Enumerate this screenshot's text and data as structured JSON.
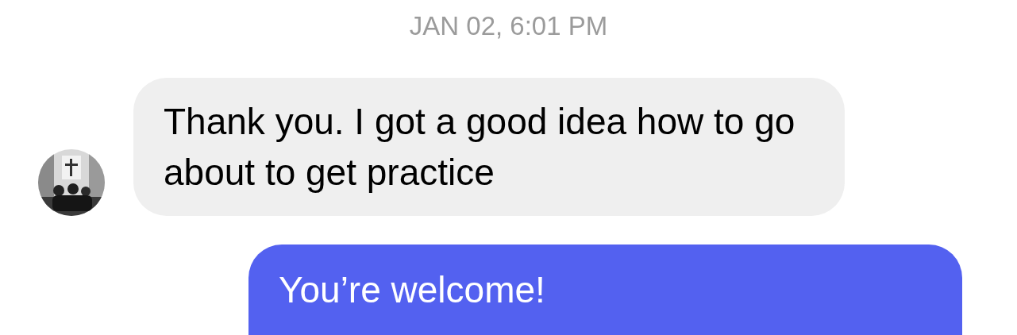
{
  "timestamp": "JAN 02, 6:01 PM",
  "messages": [
    {
      "kind": "incoming",
      "text": "Thank you. I got a good idea how to go about to get practice"
    },
    {
      "kind": "outgoing",
      "text": "You’re welcome!"
    }
  ]
}
